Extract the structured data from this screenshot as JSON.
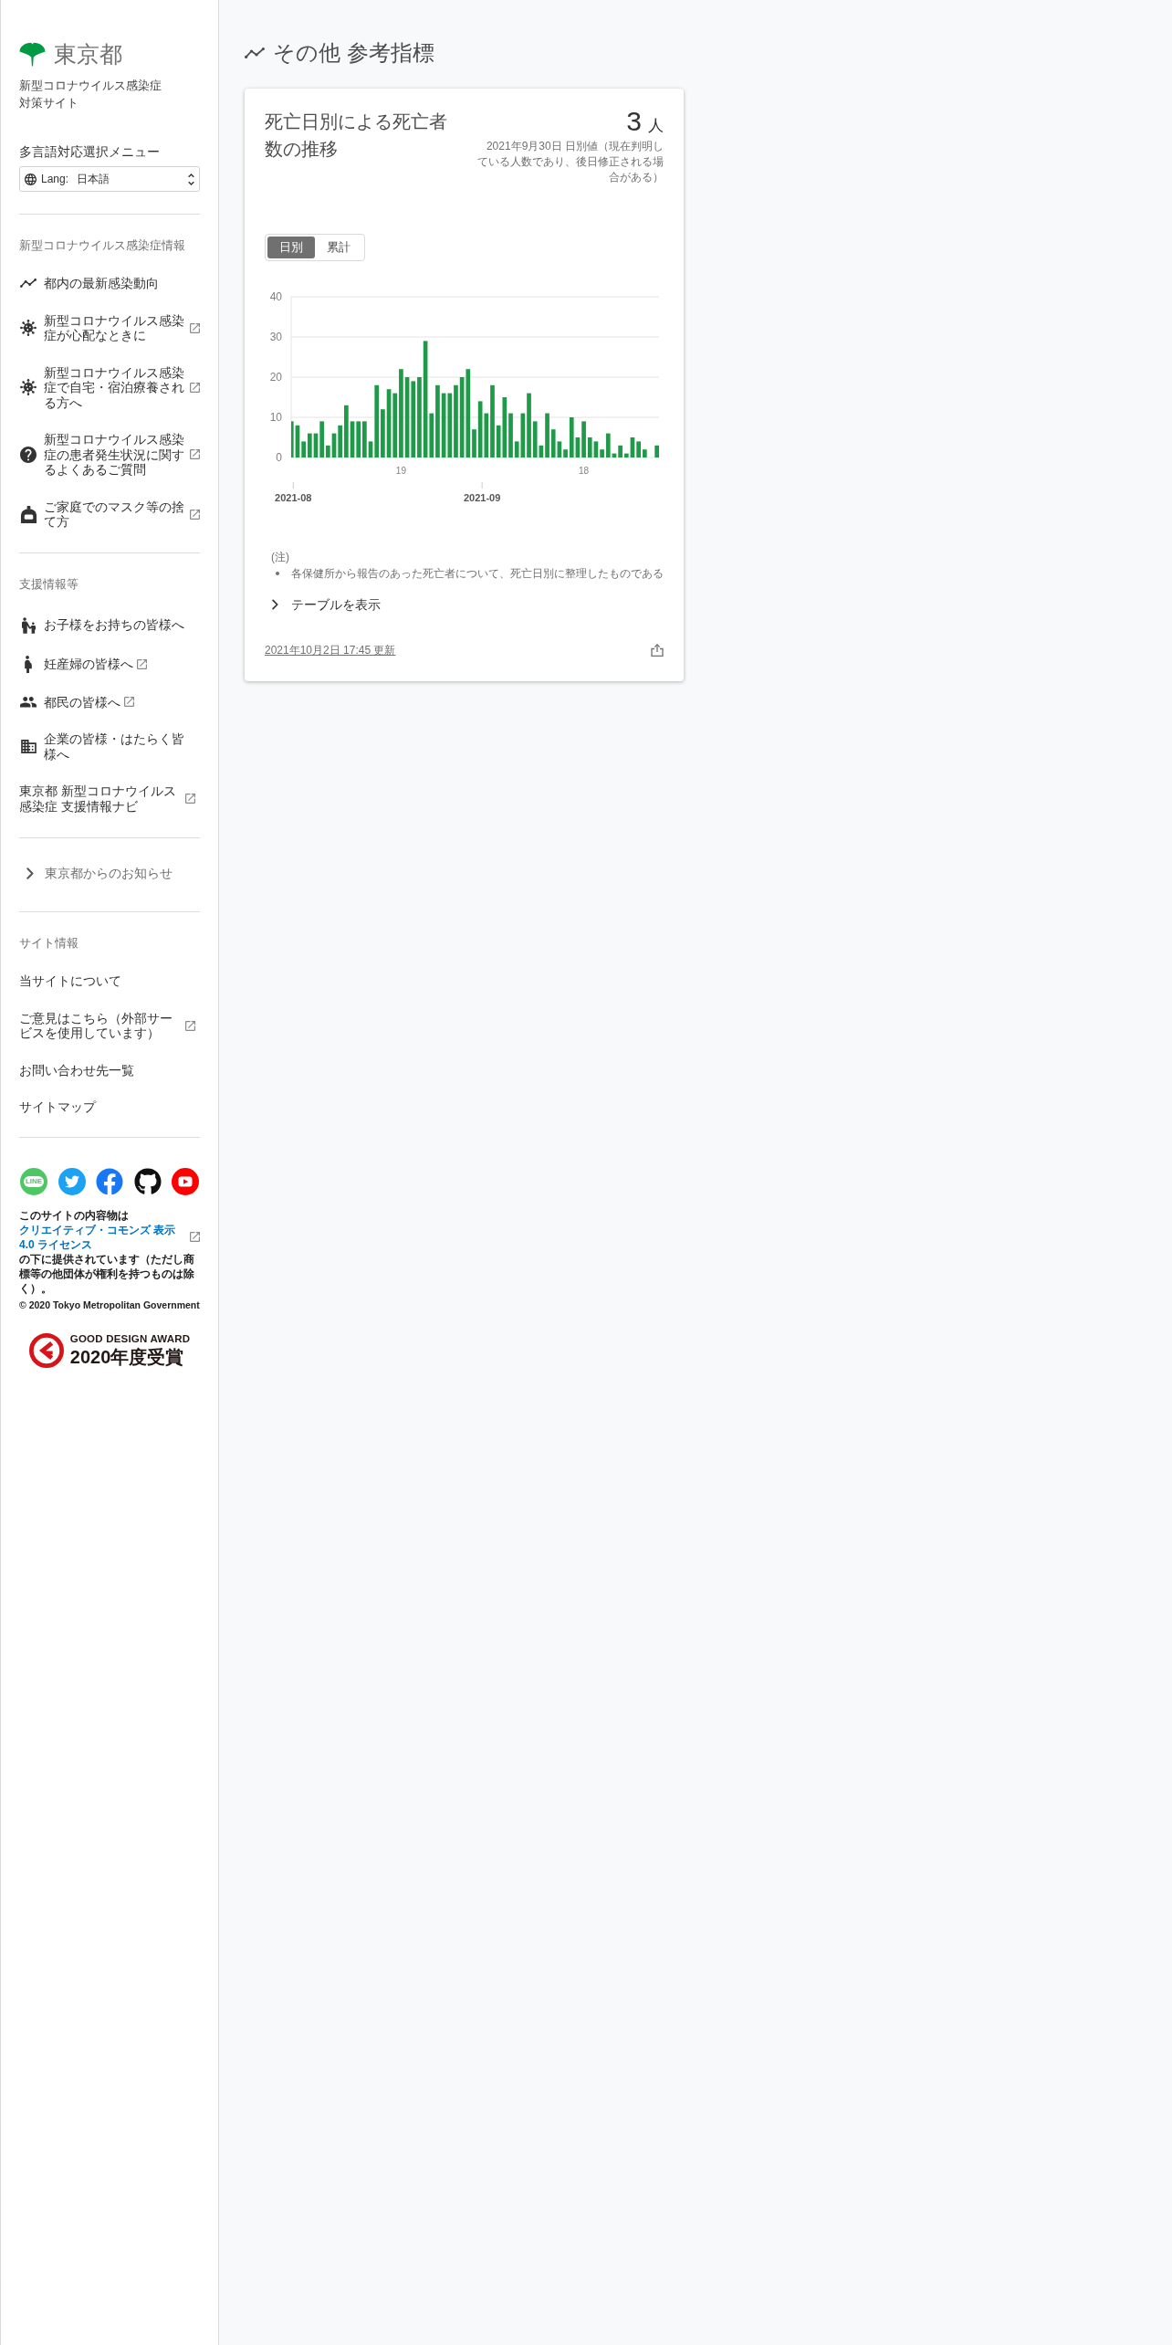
{
  "sidebar": {
    "logo": {
      "text": "東京都"
    },
    "site_title_lines": [
      "新型コロナウイルス感染症",
      "対策サイト"
    ],
    "language_menu": {
      "label": "多言語対応選択メニュー",
      "prefix": "Lang:",
      "value": "日本語"
    },
    "sections": [
      {
        "heading": "新型コロナウイルス感染症情報",
        "items": [
          {
            "label": "都内の最新感染動向",
            "external": false
          },
          {
            "label": "新型コロナウイルス感染症が心配なときに",
            "external": true
          },
          {
            "label": "新型コロナウイルス感染症で自宅・宿泊療養される方へ",
            "external": true
          },
          {
            "label": "新型コロナウイルス感染症の患者発生状況に関するよくあるご質問",
            "external": true
          },
          {
            "label": "ご家庭でのマスク等の捨て方",
            "external": true
          }
        ]
      },
      {
        "heading": "支援情報等",
        "items": [
          {
            "label": "お子様をお持ちの皆様へ",
            "external": false
          },
          {
            "label": "妊産婦の皆様へ",
            "external": true
          },
          {
            "label": "都民の皆様へ",
            "external": true
          },
          {
            "label": "企業の皆様・はたらく皆様へ",
            "external": false
          },
          {
            "label": "東京都 新型コロナウイルス感染症 支援情報ナビ",
            "external": true
          }
        ]
      }
    ],
    "notice": {
      "label": "東京都からのお知らせ",
      "expanded": false
    },
    "site_info": {
      "heading": "サイト情報",
      "items": [
        {
          "label": "当サイトについて",
          "external": false
        },
        {
          "label": "ご意見はこちら（外部サービスを使用しています）",
          "external": true
        },
        {
          "label": "お問い合わせ先一覧",
          "external": false
        },
        {
          "label": "サイトマップ",
          "external": false
        }
      ]
    },
    "social": {
      "line_text": "LINE"
    },
    "license": {
      "before": "このサイトの内容物は",
      "link": "クリエイティブ・コモンズ 表示 4.0 ライセンス",
      "after": "の下に提供されています（ただし商標等の他団体が権利を持つものは除く）。",
      "copyright": "© 2020 Tokyo Metropolitan Government"
    },
    "award": {
      "title": "GOOD DESIGN AWARD",
      "subtitle": "2020年度受賞"
    }
  },
  "main": {
    "heading": "その他 参考指標",
    "card": {
      "title": "死亡日別による死亡者数の推移",
      "value": "3",
      "unit": "人",
      "value_note": "2021年9月30日 日別値（現在判明している人数であり、後日修正される場合がある）",
      "toggle": [
        {
          "label": "日別",
          "selected": true
        },
        {
          "label": "累計",
          "selected": false
        }
      ],
      "chart_data": {
        "type": "bar",
        "series": [
          {
            "color": "#1e9a48",
            "values": [
              9,
              8,
              4,
              6,
              6,
              9,
              3,
              6,
              8,
              13,
              9,
              9,
              9,
              4,
              18,
              12,
              17,
              16,
              22,
              20,
              19,
              20,
              29,
              11,
              18,
              16,
              16,
              18,
              20,
              22,
              7,
              14,
              11,
              18,
              8,
              15,
              11,
              4,
              11,
              16,
              9,
              3,
              11,
              7,
              4,
              2,
              10,
              5,
              9,
              5,
              4,
              2,
              6,
              1,
              3,
              1,
              5,
              4,
              2,
              0,
              3
            ]
          }
        ],
        "ylim": [
          0,
          40
        ],
        "yticks": [
          0,
          10,
          20,
          30,
          40
        ],
        "grid": true
      },
      "day_labels": [
        "19",
        "18"
      ],
      "month_labels": [
        "2021-08",
        "2021-09"
      ],
      "notes_heading": "(注)",
      "notes": [
        "各保健所から報告のあった死亡者について、死亡日別に整理したものである"
      ],
      "table_toggle": {
        "label": "テーブルを表示",
        "expanded": false
      },
      "updated": "2021年10月2日 17:45 更新"
    }
  }
}
